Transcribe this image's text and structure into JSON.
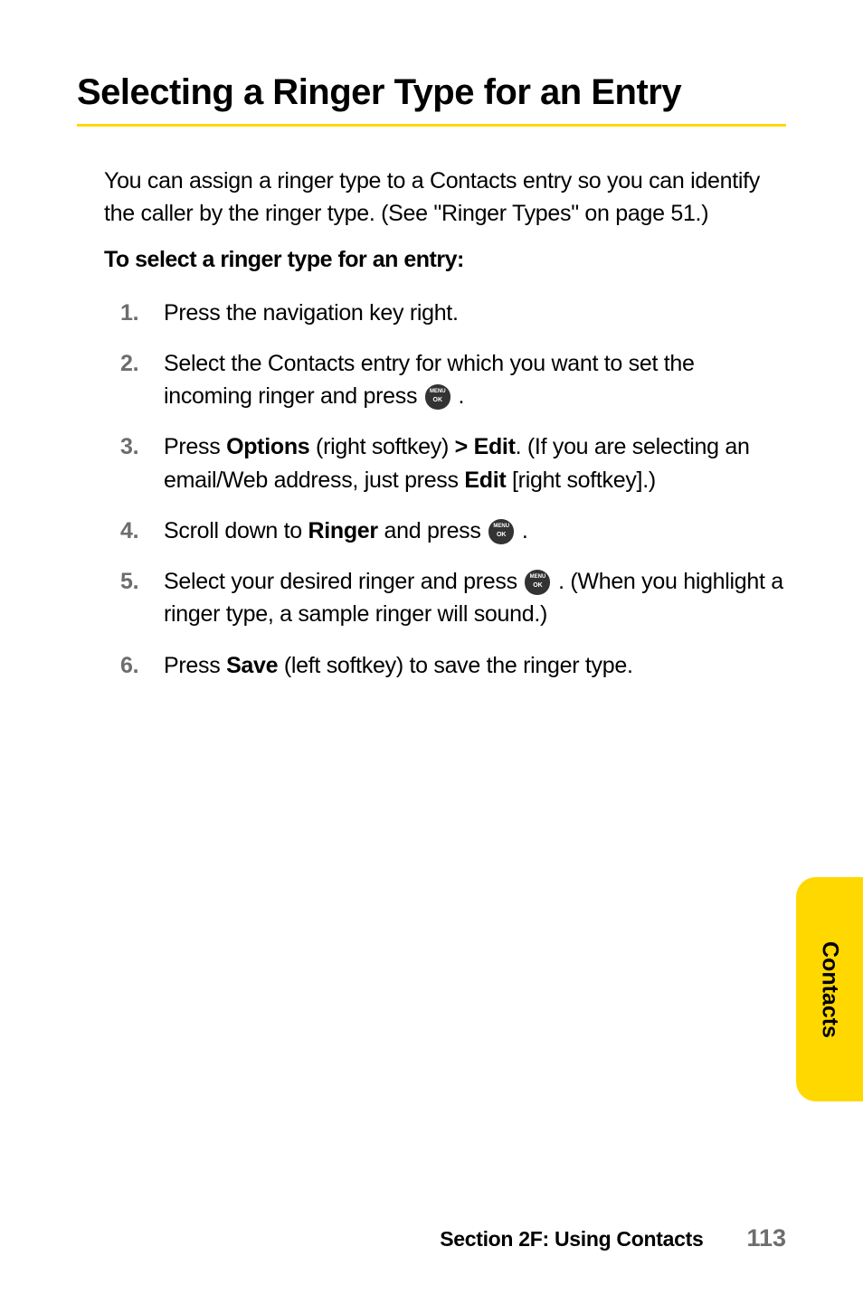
{
  "title": "Selecting a Ringer Type for an Entry",
  "intro": "You can assign a ringer type to a Contacts entry so you can identify the caller by the ringer type. (See \"Ringer Types\" on page 51.)",
  "sub_heading": "To select a ringer type for an entry:",
  "steps": {
    "s1": {
      "num": "1.",
      "text": "Press the navigation key right."
    },
    "s2": {
      "num": "2.",
      "pre": "Select the Contacts entry for which you want to set the incoming ringer and press ",
      "post": " ."
    },
    "s3": {
      "num": "3.",
      "pre": "Press ",
      "options": "Options",
      "mid1": " (right softkey) ",
      "edit_sym": "> Edit",
      "mid2": ". (If you are selecting an email/Web address, just press ",
      "edit2": "Edit",
      "post": " [right softkey].)"
    },
    "s4": {
      "num": "4.",
      "pre": "Scroll down to ",
      "ringer": "Ringer",
      "mid": " and press ",
      "post": " ."
    },
    "s5": {
      "num": "5.",
      "pre": "Select your desired ringer and press ",
      "post": " . (When you highlight a ringer type, a sample ringer will sound.)"
    },
    "s6": {
      "num": "6.",
      "pre": "Press ",
      "save": "Save",
      "post": " (left softkey) to save the ringer type."
    }
  },
  "side_tab": "Contacts",
  "footer": {
    "section": "Section 2F: Using Contacts",
    "page": "113"
  }
}
